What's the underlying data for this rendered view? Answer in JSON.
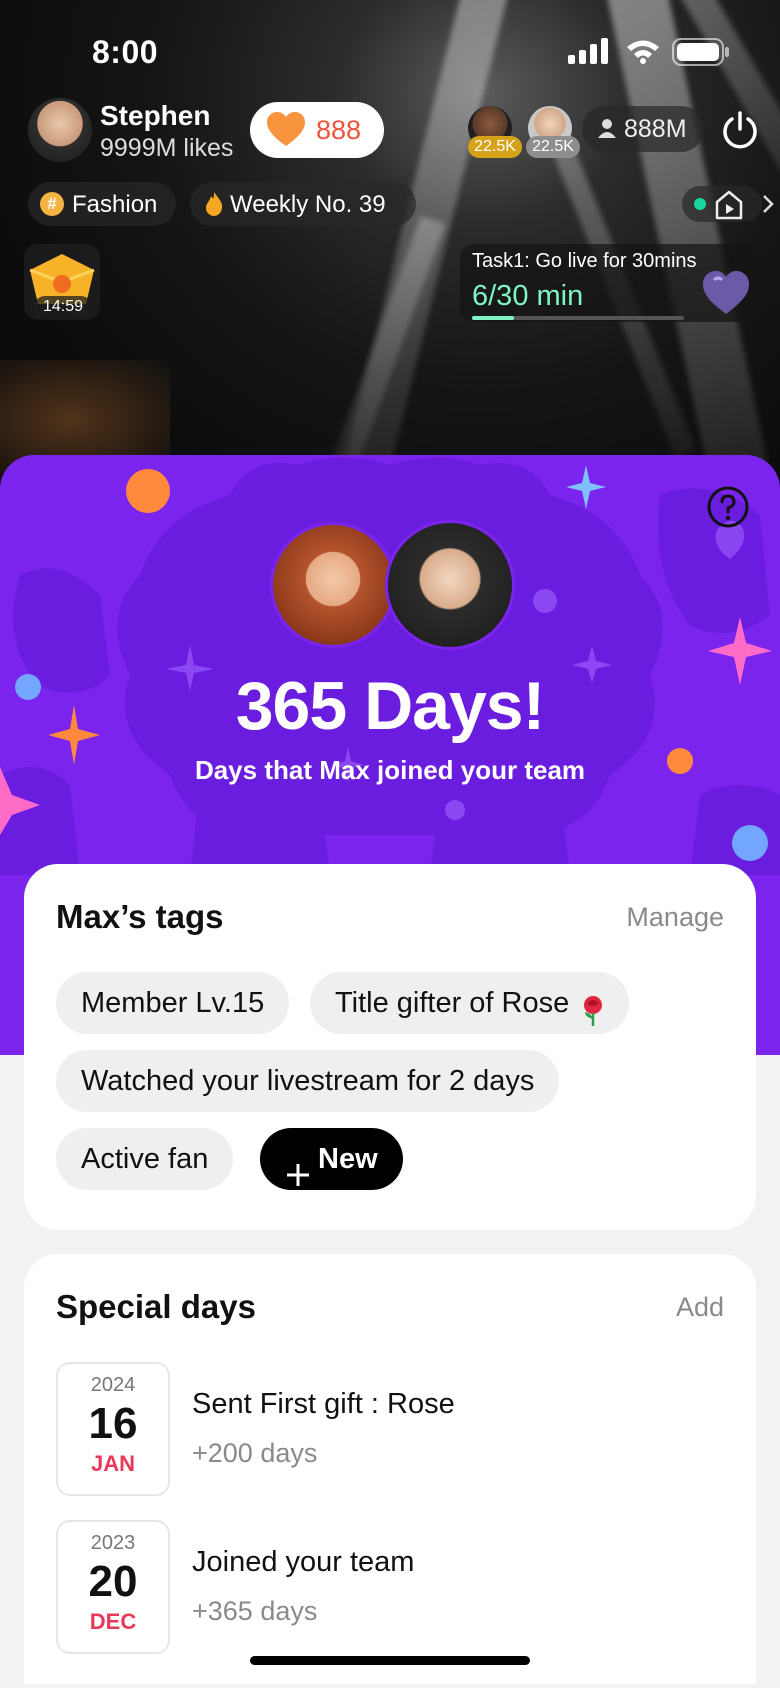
{
  "status_bar": {
    "time": "8:00"
  },
  "host": {
    "name": "Stephen",
    "likes": "9999M likes",
    "hearts": "888"
  },
  "viewers": {
    "badges": [
      "22.5K",
      "22.5K"
    ],
    "count": "888M"
  },
  "chips": {
    "category": "Fashion",
    "ranking": "Weekly No. 39"
  },
  "timer_badge": "14:59",
  "task": {
    "title": "Task1: Go live for 30mins",
    "progress_text": "6/30 min",
    "progress_fraction": 0.2
  },
  "anniversary": {
    "headline": "365 Days!",
    "subtitle": "Days that Max joined your team"
  },
  "tags_card": {
    "title": "Max’s tags",
    "manage_label": "Manage",
    "tags": [
      "Member Lv.15",
      "Title gifter of Rose",
      "Watched your livestream for 2 days",
      "Active fan"
    ],
    "new_label": "New"
  },
  "special_days": {
    "title": "Special days",
    "add_label": "Add",
    "items": [
      {
        "year": "2024",
        "day": "16",
        "month": "JAN",
        "title": "Sent First gift : Rose",
        "sub": "+200 days"
      },
      {
        "year": "2023",
        "day": "20",
        "month": "DEC",
        "title": "Joined your team",
        "sub": "+365 days"
      }
    ]
  },
  "colors": {
    "purple": "#7b24ee",
    "accent_green": "#7ef5c3",
    "heart_orange": "#f8933e",
    "month_red": "#e73a5a"
  }
}
